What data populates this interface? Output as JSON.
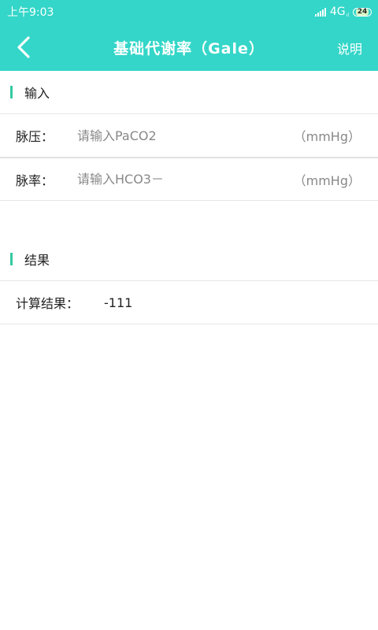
{
  "status": {
    "time": "上午9:03",
    "network": "4G",
    "network_sub": "ıl",
    "battery": "24"
  },
  "header": {
    "title": "基础代谢率（Gale）",
    "help_label": "说明"
  },
  "input_section": {
    "title": "输入",
    "fields": [
      {
        "label": "脉压：",
        "placeholder": "请输入PaCO2",
        "unit": "（mmHg）"
      },
      {
        "label": "脉率：",
        "placeholder": "请输入HCO3－",
        "unit": "（mmHg）"
      }
    ]
  },
  "result_section": {
    "title": "结果",
    "label": "计算结果：",
    "value": "-111"
  },
  "colors": {
    "primary": "#33d6c8",
    "accent_bar": "#33c9a0"
  }
}
